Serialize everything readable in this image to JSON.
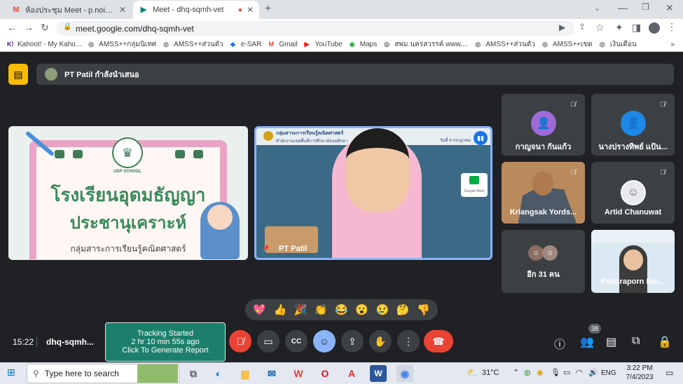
{
  "browser": {
    "tabs": [
      {
        "title": "ห้องประชุม Meet - p.noigor@gmail",
        "favicon_color": "#ea4335",
        "favicon": "M",
        "active": false
      },
      {
        "title": "Meet - dhq-sqmh-vet",
        "favicon_color": "#00897b",
        "favicon": "▶",
        "active": true
      }
    ],
    "new_tab": "+",
    "url": "meet.google.com/dhq-sqmh-vet",
    "bookmarks": [
      {
        "label": "Kahoot! - My Kaho...",
        "color": "#46178f",
        "glyph": "K!"
      },
      {
        "label": "AMSS++กลุ่มนิเทศ",
        "color": "#5f6368",
        "glyph": "◎"
      },
      {
        "label": "AMSS++ส่วนตัว",
        "color": "#5f6368",
        "glyph": "◎"
      },
      {
        "label": "e-SAR",
        "color": "#1a73e8",
        "glyph": "◆"
      },
      {
        "label": "Gmail",
        "color": "#ea4335",
        "glyph": "M"
      },
      {
        "label": "YouTube",
        "color": "#ff0000",
        "glyph": "▶"
      },
      {
        "label": "Maps",
        "color": "#34a853",
        "glyph": "◉"
      },
      {
        "label": "สพม.นครสวรรค์ www....",
        "color": "#5f6368",
        "glyph": "◎"
      },
      {
        "label": "AMSS++ส่วนตัว",
        "color": "#5f6368",
        "glyph": "◎"
      },
      {
        "label": "AMSS++เขต",
        "color": "#5f6368",
        "glyph": "◎"
      },
      {
        "label": "เงินเดือน",
        "color": "#5f6368",
        "glyph": "◎"
      }
    ],
    "bookmarks_more": "»"
  },
  "meet": {
    "presenting_text": "PT Patil กำลังนำเสนอ",
    "presentation": {
      "badge": "UDP SCHOOL",
      "line1": "โรงเรียนอุดมธัญญา",
      "line2": "ประชานุเคราะห์",
      "line3": "กลุ่มสาระการเรียนรู้คณิตศาสตร์"
    },
    "speaker_name": "PT Patil",
    "speaker_slide_header": "กลุ่มสาระการเรียนรู้คณิตศาสตร์",
    "speaker_slide_sub": "สำนักงานเขตพื้นที่การศึกษามัธยมศึกษา",
    "speaker_slide_right": "วันที่ 4 กรกฎาคม",
    "google_meet_label": "Google Meet",
    "participants": [
      {
        "name": "กาญจนา กันแก้ว",
        "avatar_color": "#9c6ad9",
        "type": "avatar"
      },
      {
        "name": "นางปรางทิพย์ แป้น...",
        "avatar_color": "#1e88e5",
        "type": "avatar"
      },
      {
        "name": "Kriangsak Yords...",
        "type": "video"
      },
      {
        "name": "Artid Chanuwat",
        "type": "photo"
      },
      {
        "name": "อีก 31 คน",
        "type": "others"
      },
      {
        "name": "Pattaraporn Noi...",
        "type": "video"
      }
    ],
    "reactions": [
      "💖",
      "👍",
      "🎉",
      "👏",
      "😂",
      "😮",
      "😢",
      "🤔",
      "👎"
    ],
    "time": "15:22",
    "meeting_code": "dhq-sqmh...",
    "tracking": {
      "line1": "Tracking Started",
      "line2": "2 hr 10 min 55s ago",
      "line3": "Click To Generate Report"
    },
    "people_count": "38"
  },
  "taskbar": {
    "search_placeholder": "Type here to search",
    "weather": "31°C",
    "language": "ENG",
    "clock_time": "3:22 PM",
    "clock_date": "7/4/2023"
  }
}
